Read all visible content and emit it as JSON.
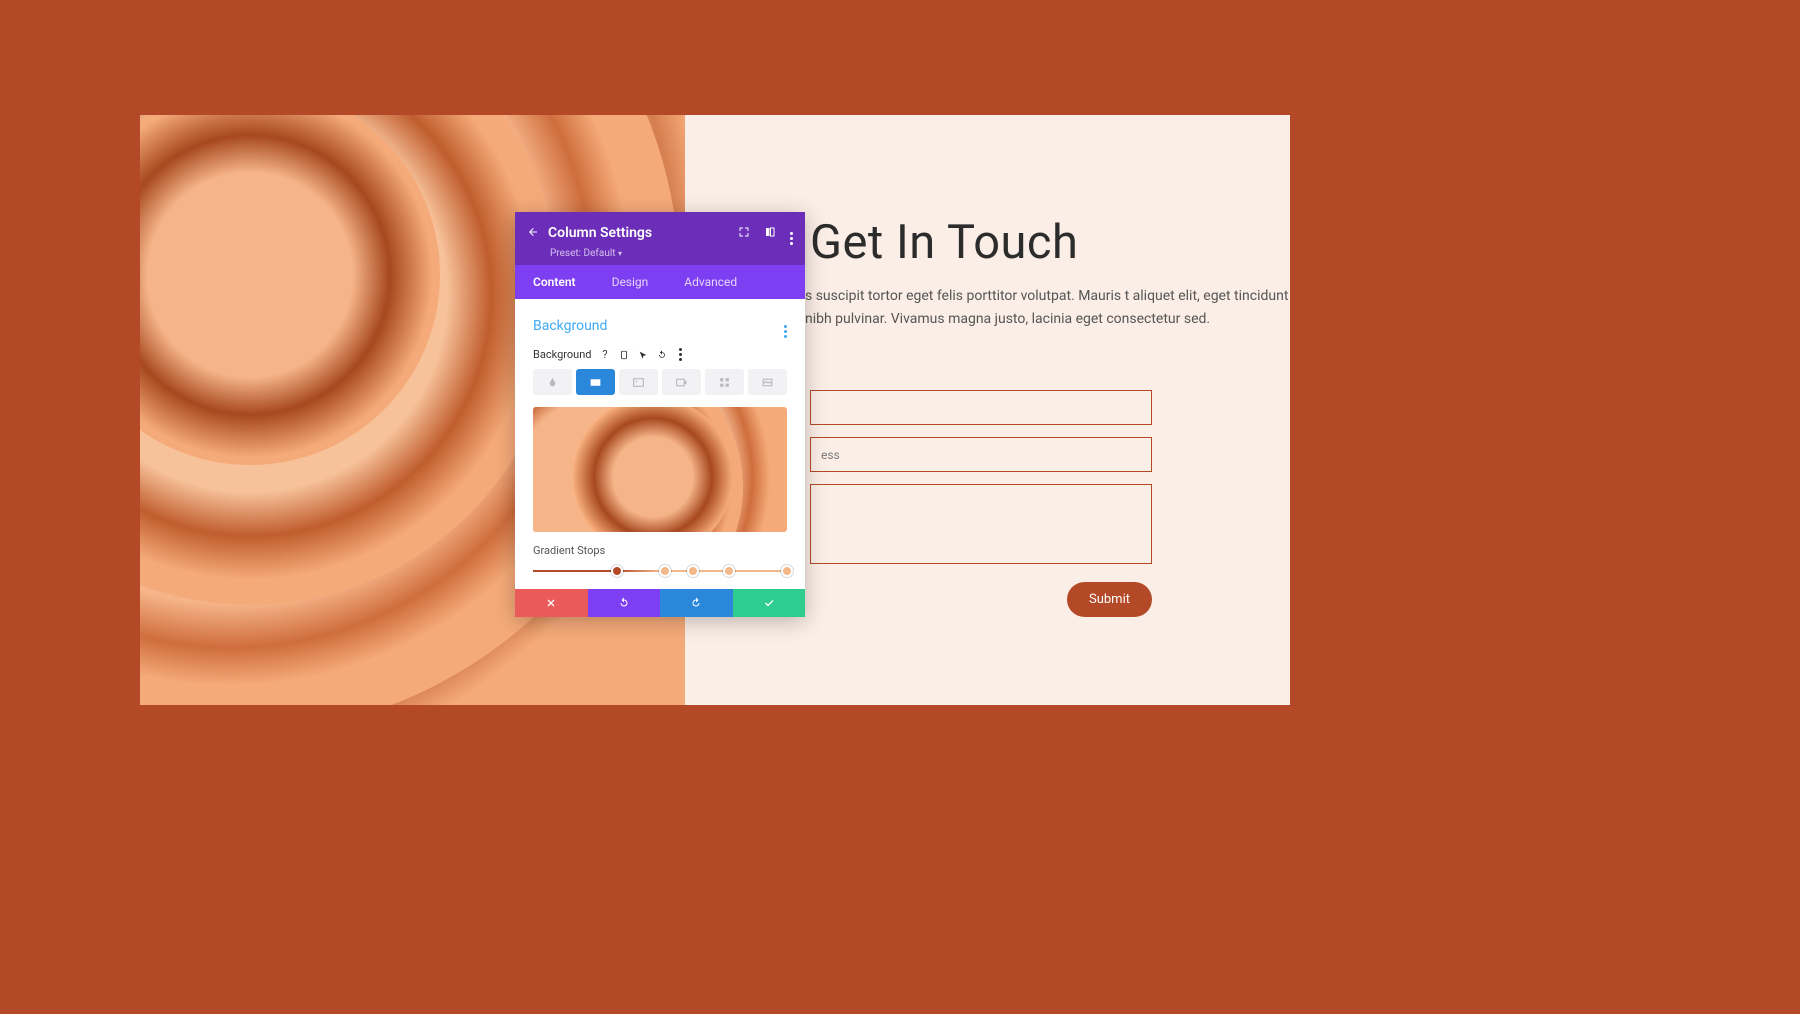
{
  "page": {
    "heading": "Get In Touch",
    "body_text": "s suscipit tortor eget felis porttitor volutpat. Mauris t aliquet elit, eget tincidunt nibh pulvinar. Vivamus magna justo, lacinia eget consectetur sed.",
    "form": {
      "field1_placeholder": "",
      "field2_placeholder": "ess",
      "field3_placeholder": "",
      "submit_label": "Submit"
    }
  },
  "modal": {
    "title": "Column Settings",
    "preset_label": "Preset: Default",
    "tabs": [
      "Content",
      "Design",
      "Advanced"
    ],
    "active_tab": "Content",
    "section_title": "Background",
    "field_label": "Background",
    "bg_types": [
      "color",
      "gradient",
      "image",
      "video",
      "pattern",
      "mask"
    ],
    "active_bg_type": "gradient",
    "stops_label": "Gradient Stops",
    "gradient_stops": [
      {
        "position": 33,
        "color": "#b34927"
      },
      {
        "position": 52,
        "color": "#f2b88a"
      },
      {
        "position": 63,
        "color": "#f2b88a"
      },
      {
        "position": 77,
        "color": "#f2b88a"
      },
      {
        "position": 100,
        "color": "#f2b88a"
      }
    ],
    "footer_buttons": [
      "cancel",
      "undo",
      "redo",
      "save"
    ]
  },
  "colors": {
    "brand_orange": "#b34927",
    "purple": "#6c2eb9",
    "purple_light": "#7e3ff2",
    "blue": "#2b87da",
    "green": "#2ecc8f",
    "red": "#eb5a5a"
  }
}
